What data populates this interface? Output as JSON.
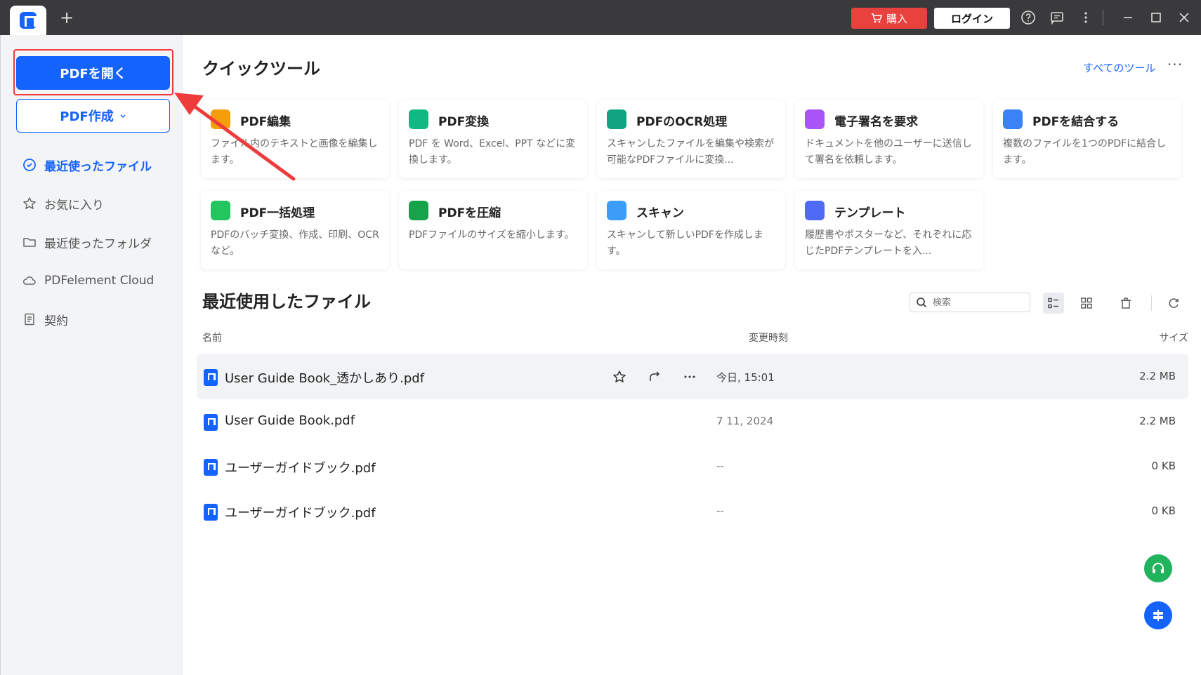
{
  "titlebar": {
    "new_tab": "+",
    "buy_label": "購入",
    "login_label": "ログイン"
  },
  "sidebar": {
    "open_pdf": "PDFを開く",
    "create_pdf": "PDF作成",
    "items": [
      {
        "label": "最近使ったファイル",
        "icon": "clock-icon",
        "active": true
      },
      {
        "label": "お気に入り",
        "icon": "star-icon",
        "active": false
      },
      {
        "label": "最近使ったフォルダ",
        "icon": "folder-icon",
        "active": false
      },
      {
        "label": "PDFelement Cloud",
        "icon": "cloud-icon",
        "active": false
      },
      {
        "label": "契約",
        "icon": "document-icon",
        "active": false
      }
    ]
  },
  "quick_tools": {
    "title": "クイックツール",
    "all_tools": "すべてのツール",
    "cards": [
      {
        "title": "PDF編集",
        "desc": "ファイル内のテキストと画像を編集します。",
        "color": "#f59e0b"
      },
      {
        "title": "PDF変換",
        "desc": "PDF を Word、Excel、PPT などに変換します。",
        "color": "#10b981"
      },
      {
        "title": "PDFのOCR処理",
        "desc": "スキャンしたファイルを編集や検索が可能なPDFファイルに変換...",
        "color": "#0fa37f"
      },
      {
        "title": "電子署名を要求",
        "desc": "ドキュメントを他のユーザーに送信して署名を依頼します。",
        "color": "#a855f7"
      },
      {
        "title": "PDFを結合する",
        "desc": "複数のファイルを1つのPDFに結合します。",
        "color": "#3b82f6"
      },
      {
        "title": "PDF一括処理",
        "desc": "PDFのバッチ変換、作成、印刷、OCRなど。",
        "color": "#22c55e"
      },
      {
        "title": "PDFを圧縮",
        "desc": "PDFファイルのサイズを縮小します。",
        "color": "#16a34a"
      },
      {
        "title": "スキャン",
        "desc": "スキャンして新しいPDFを作成します。",
        "color": "#3b9df8"
      },
      {
        "title": "テンプレート",
        "desc": "履歴書やポスターなど、それぞれに応じたPDFテンプレートを入...",
        "color": "#4f6bf5"
      }
    ]
  },
  "recent": {
    "title": "最近使用したファイル",
    "search_placeholder": "検索",
    "columns": {
      "name": "名前",
      "modified": "変更時刻",
      "size": "サイズ"
    },
    "files": [
      {
        "name": "User Guide Book_透かしあり.pdf",
        "modified": "今日, 15:01",
        "size": "2.2 MB"
      },
      {
        "name": "User Guide Book.pdf",
        "modified": "7 11, 2024",
        "size": "2.2 MB"
      },
      {
        "name": "ユーザーガイドブック.pdf",
        "modified": "--",
        "size": "0 KB"
      },
      {
        "name": "ユーザーガイドブック.pdf",
        "modified": "--",
        "size": "0 KB"
      }
    ]
  },
  "colors": {
    "accent": "#1463ff",
    "buy": "#e8413e",
    "annotation": "#ee3b3b"
  }
}
